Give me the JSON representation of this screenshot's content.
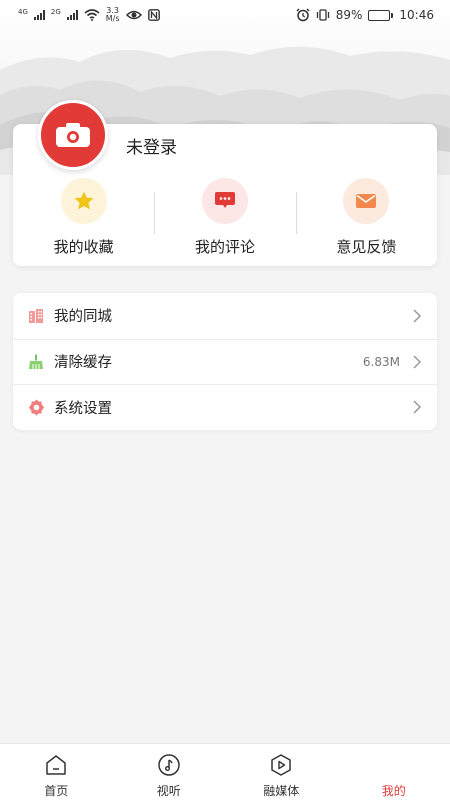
{
  "status_bar": {
    "net1": "4G",
    "net2": "2G",
    "speed_value": "3.3",
    "speed_unit": "M/s",
    "battery": "89%",
    "battery_level": 0.89,
    "time": "10:46",
    "icons": [
      "signal-icon",
      "wifi-icon",
      "eye-icon",
      "nfc-icon",
      "alarm-icon",
      "vibrate-icon",
      "battery-icon"
    ]
  },
  "profile": {
    "login_status": "未登录",
    "avatar_icon": "camera-icon",
    "avatar_color": "#e23a37"
  },
  "actions": [
    {
      "label": "我的收藏",
      "icon": "star-icon",
      "color": "#f0c419",
      "bg": "#fdf3d8"
    },
    {
      "label": "我的评论",
      "icon": "comment-icon",
      "color": "#e23a37",
      "bg": "#fde6e6"
    },
    {
      "label": "意见反馈",
      "icon": "mail-icon",
      "color": "#f2884b",
      "bg": "#fdeadf"
    }
  ],
  "menu": [
    {
      "label": "我的同城",
      "icon": "building-icon",
      "value": ""
    },
    {
      "label": "清除缓存",
      "icon": "broom-icon",
      "value": "6.83M"
    },
    {
      "label": "系统设置",
      "icon": "gear-icon",
      "value": ""
    }
  ],
  "nav": [
    {
      "label": "首页",
      "icon": "home-icon",
      "active": false
    },
    {
      "label": "视听",
      "icon": "music-icon",
      "active": false
    },
    {
      "label": "融媒体",
      "icon": "play-icon",
      "active": false
    },
    {
      "label": "我的",
      "icon": "profile-icon",
      "active": true
    }
  ],
  "accent": "#e23a37"
}
